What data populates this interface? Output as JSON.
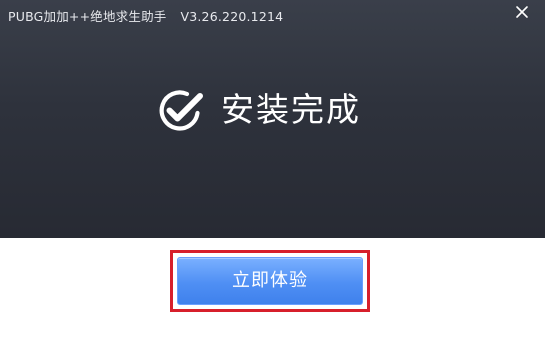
{
  "window": {
    "title": "PUBG加加++绝地求生助手",
    "version": "V3.26.220.1214",
    "close_icon": "close-icon"
  },
  "status": {
    "icon": "check-circle-icon",
    "message": "安装完成"
  },
  "actions": {
    "primary_label": "立即体验"
  },
  "colors": {
    "header_bg": "#2e323c",
    "accent_blue": "#4f8ff4",
    "highlight_red": "#d71f2b",
    "text_white": "#ffffff"
  }
}
